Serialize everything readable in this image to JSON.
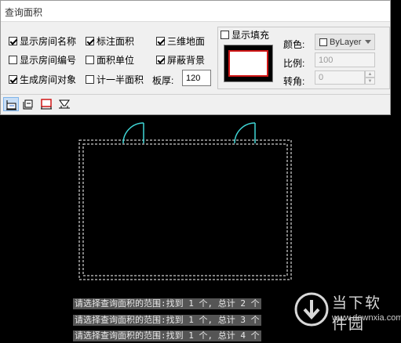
{
  "dialog": {
    "title": "查询面积",
    "options": {
      "show_room_name": {
        "label": "显示房间名称",
        "checked": true
      },
      "mark_area": {
        "label": "标注面积",
        "checked": true
      },
      "three_d_floor": {
        "label": "三维地面",
        "checked": true
      },
      "show_room_number": {
        "label": "显示房间编号",
        "checked": false
      },
      "area_unit": {
        "label": "面积单位",
        "checked": false
      },
      "mask_background": {
        "label": "屏蔽背景",
        "checked": true
      },
      "create_room_object": {
        "label": "生成房间对象",
        "checked": true
      },
      "half_area": {
        "label": "计一半面积",
        "checked": false
      }
    },
    "thickness": {
      "label": "板厚:",
      "value": "120"
    },
    "fill": {
      "label": "显示填充",
      "checked": false
    },
    "color": {
      "label": "颜色:",
      "value": "ByLayer"
    },
    "scale": {
      "label": "比例:",
      "value": "100"
    },
    "angle": {
      "label": "转角:",
      "value": "0"
    },
    "toolbar": [
      "room-area-icon",
      "building-outline-icon",
      "apartment-area-icon",
      "balcony-area-icon"
    ]
  },
  "command_lines": [
    "请选择查询面积的范围:找到 1 个, 总计 2 个",
    "请选择查询面积的范围:找到 1 个, 总计 3 个",
    "请选择查询面积的范围:找到 1 个, 总计 4 个"
  ],
  "watermark": {
    "brand": "当下软件园",
    "url": "www.downxia.com"
  },
  "colors": {
    "canvas": "#000000",
    "wall": "#ffffff",
    "door": "#3fd7d7",
    "preview_border": "#d01616"
  }
}
